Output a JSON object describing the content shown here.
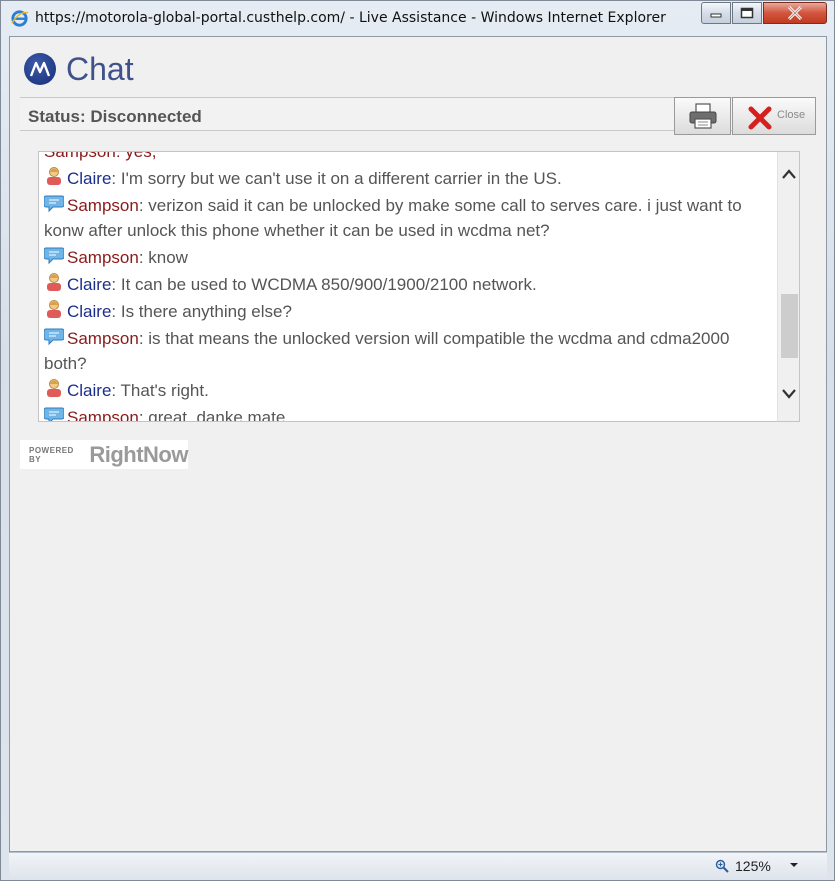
{
  "window": {
    "title": "https://motorola-global-portal.custhelp.com/ - Live Assistance - Windows Internet Explorer"
  },
  "header": {
    "title": "Chat"
  },
  "status": {
    "text": "Status: Disconnected"
  },
  "toolbar": {
    "close_label": "Close"
  },
  "transcript": {
    "partial_line": "Sampson: yes,",
    "messages": [
      {
        "speaker": "Claire",
        "text": ": I'm sorry but we can't use it on a different carrier in the US."
      },
      {
        "speaker": "Sampson",
        "text": ": verizon said it can be unlocked by make some call to serves care. i just want to konw after unlock this phone whether it can be used in wcdma net?"
      },
      {
        "speaker": "Sampson",
        "text": ": know"
      },
      {
        "speaker": "Claire",
        "text": ": It can be used to WCDMA 850/900/1900/2100 network."
      },
      {
        "speaker": "Claire",
        "text": ": Is there anything else?"
      },
      {
        "speaker": "Sampson",
        "text": ": is that means the unlocked version will compatible the wcdma and cdma2000 both?"
      },
      {
        "speaker": "Claire",
        "text": ": That's right."
      },
      {
        "speaker": "Sampson",
        "text": ": great ,danke mate"
      }
    ]
  },
  "branding": {
    "powered_by": "POWERED BY",
    "vendor": "RightNow"
  },
  "statusbar": {
    "zoom": "125%"
  },
  "colors": {
    "claire": "#1c2e8c",
    "sampson": "#8b1a1a",
    "title": "#3f5289"
  }
}
